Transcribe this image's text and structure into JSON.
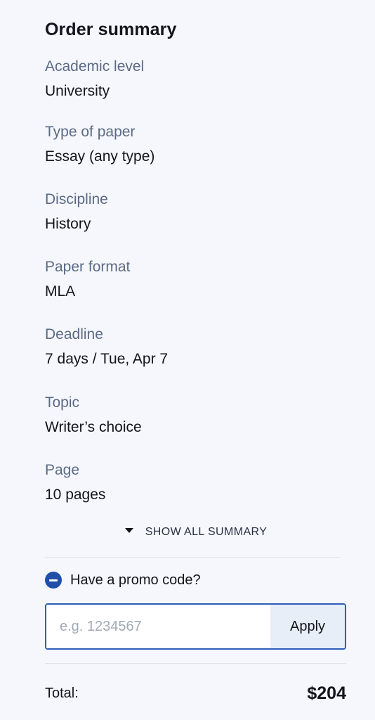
{
  "summary": {
    "title": "Order summary",
    "items": [
      {
        "label": "Academic level",
        "value": "University"
      },
      {
        "label": "Type of paper",
        "value": "Essay (any type)"
      },
      {
        "label": "Discipline",
        "value": "History"
      },
      {
        "label": "Paper format",
        "value": "MLA"
      },
      {
        "label": "Deadline",
        "value": "7 days / Tue, Apr 7"
      },
      {
        "label": "Topic",
        "value": "Writer’s choice"
      },
      {
        "label": "Page",
        "value": "10 pages"
      }
    ],
    "show_all_label": "SHOW ALL SUMMARY",
    "show_all_icon": "caret-down-icon"
  },
  "promo": {
    "toggle_label": "Have a promo code?",
    "toggle_icon": "minus-circle-icon",
    "placeholder": "e.g. 1234567",
    "value": "",
    "apply_label": "Apply"
  },
  "total": {
    "label": "Total:",
    "amount": "$204"
  },
  "colors": {
    "background": "#f5f7fc",
    "label": "#5b6a85",
    "accent": "#1f4fa8",
    "input_border": "#2c5cb8",
    "apply_bg": "#e8eef8"
  }
}
